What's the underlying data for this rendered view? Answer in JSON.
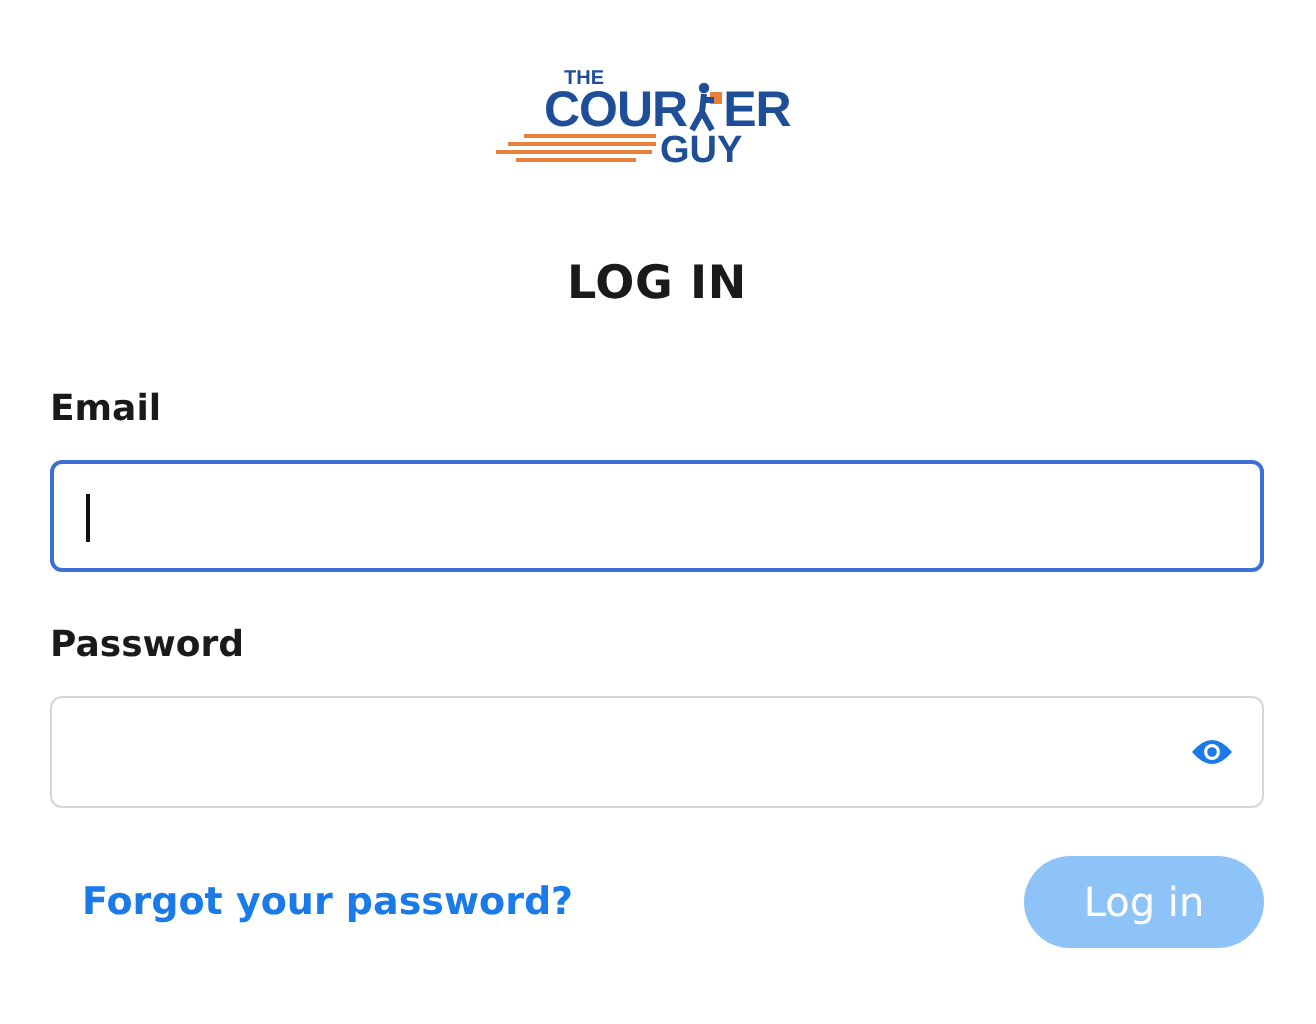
{
  "logo": {
    "top_word": "THE",
    "main_word_start": "COUR",
    "main_word_end": "ER",
    "bottom_word": "GUY"
  },
  "heading": "LOG IN",
  "fields": [
    {
      "label": "Email",
      "kind": "text",
      "focused": true
    },
    {
      "label": "Password",
      "kind": "password",
      "focused": false
    }
  ],
  "forgot_link": "Forgot your password?",
  "login_button": {
    "label": "Log in",
    "disabled": true
  }
}
